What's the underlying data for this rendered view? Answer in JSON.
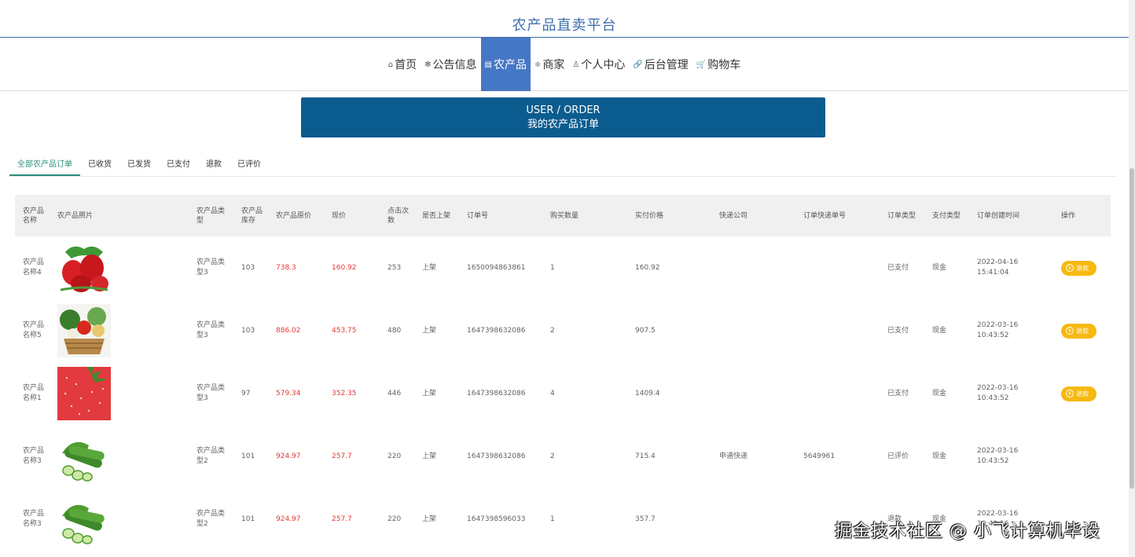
{
  "site": {
    "title": "农产品直卖平台"
  },
  "nav": [
    {
      "icon": "⌂",
      "icon_name": "home-icon",
      "label": "首页",
      "active": false
    },
    {
      "icon": "✻",
      "icon_name": "snowflake-icon",
      "label": "公告信息",
      "active": false
    },
    {
      "icon": "▤",
      "icon_name": "list-icon",
      "label": "农产品",
      "active": true
    },
    {
      "icon": "≑",
      "icon_name": "shop-icon",
      "label": "商家",
      "active": false
    },
    {
      "icon": "♙",
      "icon_name": "person-icon",
      "label": "个人中心",
      "active": false
    },
    {
      "icon": "🔗",
      "icon_name": "link-icon",
      "label": "后台管理",
      "active": false
    },
    {
      "icon": "🛒",
      "icon_name": "cart-icon",
      "label": "购物车",
      "active": false
    }
  ],
  "banner": {
    "en": "USER / ORDER",
    "cn": "我的农产品订单"
  },
  "tabs": [
    "全部农产品订单",
    "已收货",
    "已发货",
    "已支付",
    "退款",
    "已评价"
  ],
  "table": {
    "headers": [
      "农产品名称",
      "农产品照片",
      "农产品类型",
      "农产品库存",
      "农产品原价",
      "现价",
      "点击次数",
      "是否上架",
      "订单号",
      "购买数量",
      "实付价格",
      "快递公司",
      "订单快递单号",
      "订单类型",
      "支付类型",
      "订单创建时间",
      "操作"
    ],
    "rows": [
      {
        "name": "农产品名称4",
        "photo": "strawberries",
        "type": "农产品类型3",
        "stock": "103",
        "orig_price": "738.3",
        "price": "160.92",
        "clicks": "253",
        "listed": "上架",
        "order_no": "1650094863861",
        "qty": "1",
        "paid": "160.92",
        "courier": "",
        "tracking": "",
        "status": "已支付",
        "pay_type": "现金",
        "created": "2022-04-16 15:41:04",
        "action": "退款"
      },
      {
        "name": "农产品名称5",
        "photo": "vegetable-basket",
        "type": "农产品类型3",
        "stock": "103",
        "orig_price": "886.02",
        "price": "453.75",
        "clicks": "480",
        "listed": "上架",
        "order_no": "1647398632086",
        "qty": "2",
        "paid": "907.5",
        "courier": "",
        "tracking": "",
        "status": "已支付",
        "pay_type": "现金",
        "created": "2022-03-16 10:43:52",
        "action": "退款"
      },
      {
        "name": "农产品名称1",
        "photo": "strawberry-closeup",
        "type": "农产品类型3",
        "stock": "97",
        "orig_price": "579.34",
        "price": "352.35",
        "clicks": "446",
        "listed": "上架",
        "order_no": "1647398632086",
        "qty": "4",
        "paid": "1409.4",
        "courier": "",
        "tracking": "",
        "status": "已支付",
        "pay_type": "现金",
        "created": "2022-03-16 10:43:52",
        "action": "退款"
      },
      {
        "name": "农产品名称3",
        "photo": "cucumbers",
        "type": "农产品类型2",
        "stock": "101",
        "orig_price": "924.97",
        "price": "257.7",
        "clicks": "220",
        "listed": "上架",
        "order_no": "1647398632086",
        "qty": "2",
        "paid": "715.4",
        "courier": "申通快递",
        "tracking": "5649961",
        "status": "已评价",
        "pay_type": "现金",
        "created": "2022-03-16 10:43:52",
        "action": ""
      },
      {
        "name": "农产品名称3",
        "photo": "cucumbers",
        "type": "农产品类型2",
        "stock": "101",
        "orig_price": "924.97",
        "price": "257.7",
        "clicks": "220",
        "listed": "上架",
        "order_no": "1647398596033",
        "qty": "1",
        "paid": "357.7",
        "courier": "",
        "tracking": "",
        "status": "退款",
        "pay_type": "现金",
        "created": "2022-03-16 10:43:16",
        "action": ""
      }
    ]
  },
  "watermark": "掘金技术社区 @ 小飞计算机毕设"
}
